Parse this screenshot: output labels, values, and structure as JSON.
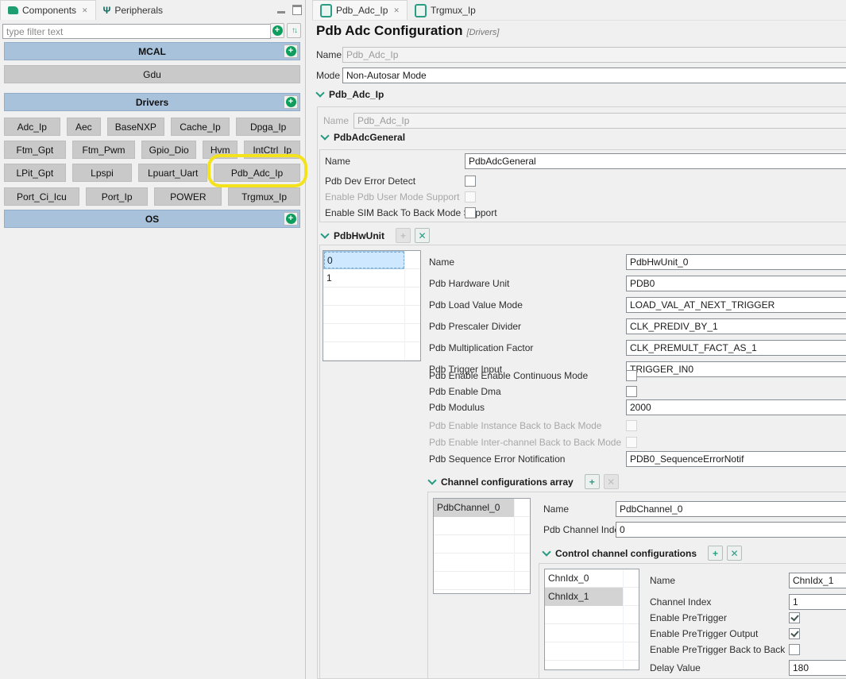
{
  "icons": {
    "close": "✕",
    "plus": "+",
    "remove": "✕",
    "sort_up": "↑",
    "sort_down": "↓",
    "peripherals_glyph": "Ψ"
  },
  "left_panel": {
    "tabs": [
      {
        "label": "Components"
      },
      {
        "label": "Peripherals"
      }
    ],
    "filter": {
      "placeholder": "type filter text"
    },
    "groups": {
      "mcal": {
        "label": "MCAL",
        "buttons": [
          "Gdu"
        ]
      },
      "drivers": {
        "label": "Drivers",
        "highlighted": "Pdb_Adc_Ip",
        "rows": [
          [
            "Adc_Ip",
            "Aec",
            "BaseNXP",
            "Cache_Ip",
            "Dpga_Ip"
          ],
          [
            "Ftm_Gpt",
            "Ftm_Pwm",
            "Gpio_Dio",
            "Hvm",
            "IntCtrl_Ip"
          ],
          [
            "LPit_Gpt",
            "Lpspi",
            "Lpuart_Uart",
            "Pdb_Adc_Ip"
          ],
          [
            "Port_Ci_Icu",
            "Port_Ip",
            "POWER",
            "Trgmux_Ip"
          ]
        ]
      },
      "os": {
        "label": "OS"
      }
    }
  },
  "editor": {
    "tabs": [
      {
        "label": "Pdb_Adc_Ip"
      },
      {
        "label": "Trgmux_Ip"
      }
    ],
    "title": "Pdb Adc Configuration",
    "category": "[Drivers]",
    "top": {
      "name_label": "Name",
      "name_value": "Pdb_Adc_Ip",
      "mode_label": "Mode",
      "mode_value": "Non-Autosar Mode"
    },
    "root_section": {
      "label": "Pdb_Adc_Ip",
      "name_label": "Name",
      "name_value": "Pdb_Adc_Ip"
    },
    "general": {
      "label": "PdbAdcGeneral",
      "name_label": "Name",
      "name_value": "PdbAdcGeneral",
      "cb_dev_error": "Pdb Dev Error Detect",
      "cb_user_mode": "Enable Pdb User Mode Support",
      "cb_sim_b2b": "Enable SIM Back To Back Mode Support"
    },
    "hw_unit": {
      "label": "PdbHwUnit",
      "items": [
        "0",
        "1"
      ],
      "selected": "0",
      "f_name": "Name",
      "v_name": "PdbHwUnit_0",
      "f_hw": "Pdb Hardware Unit",
      "v_hw": "PDB0",
      "f_load": "Pdb Load Value Mode",
      "v_load": "LOAD_VAL_AT_NEXT_TRIGGER",
      "f_presc": "Pdb Prescaler Divider",
      "v_presc": "CLK_PREDIV_BY_1",
      "f_mult": "Pdb Multiplication Factor",
      "v_mult": "CLK_PREMULT_FACT_AS_1",
      "f_trig": "Pdb Trigger Input",
      "v_trig": "TRIGGER_IN0",
      "cb_continuous": "Pdb Enable Enable Continuous Mode",
      "cb_dma": "Pdb Enable Dma",
      "f_modulus": "Pdb Modulus",
      "v_modulus": "2000",
      "cb_instance_b2b": "Pdb Enable Instance Back to Back Mode",
      "cb_interchannel_b2b": "Pdb Enable Inter-channel Back to Back Mode",
      "f_seq_err": "Pdb Sequence Error Notification",
      "v_seq_err": "PDB0_SequenceErrorNotif"
    },
    "channels": {
      "label": "Channel configurations array",
      "items": [
        "PdbChannel_0"
      ],
      "selected": "PdbChannel_0",
      "f_name": "Name",
      "v_name": "PdbChannel_0",
      "f_idx": "Pdb Channel Index",
      "v_idx": "0"
    },
    "control": {
      "label": "Control channel configurations",
      "items": [
        "ChnIdx_0",
        "ChnIdx_1"
      ],
      "selected": "ChnIdx_1",
      "f_name": "Name",
      "v_name": "ChnIdx_1",
      "f_idx": "Channel Index",
      "v_idx": "1",
      "cb_pretrigger": "Enable PreTrigger",
      "cb_pretrigger_out": "Enable PreTrigger Output",
      "cb_pretrigger_b2b": "Enable PreTrigger Back to Back",
      "f_delay": "Delay Value",
      "v_delay": "180"
    }
  }
}
